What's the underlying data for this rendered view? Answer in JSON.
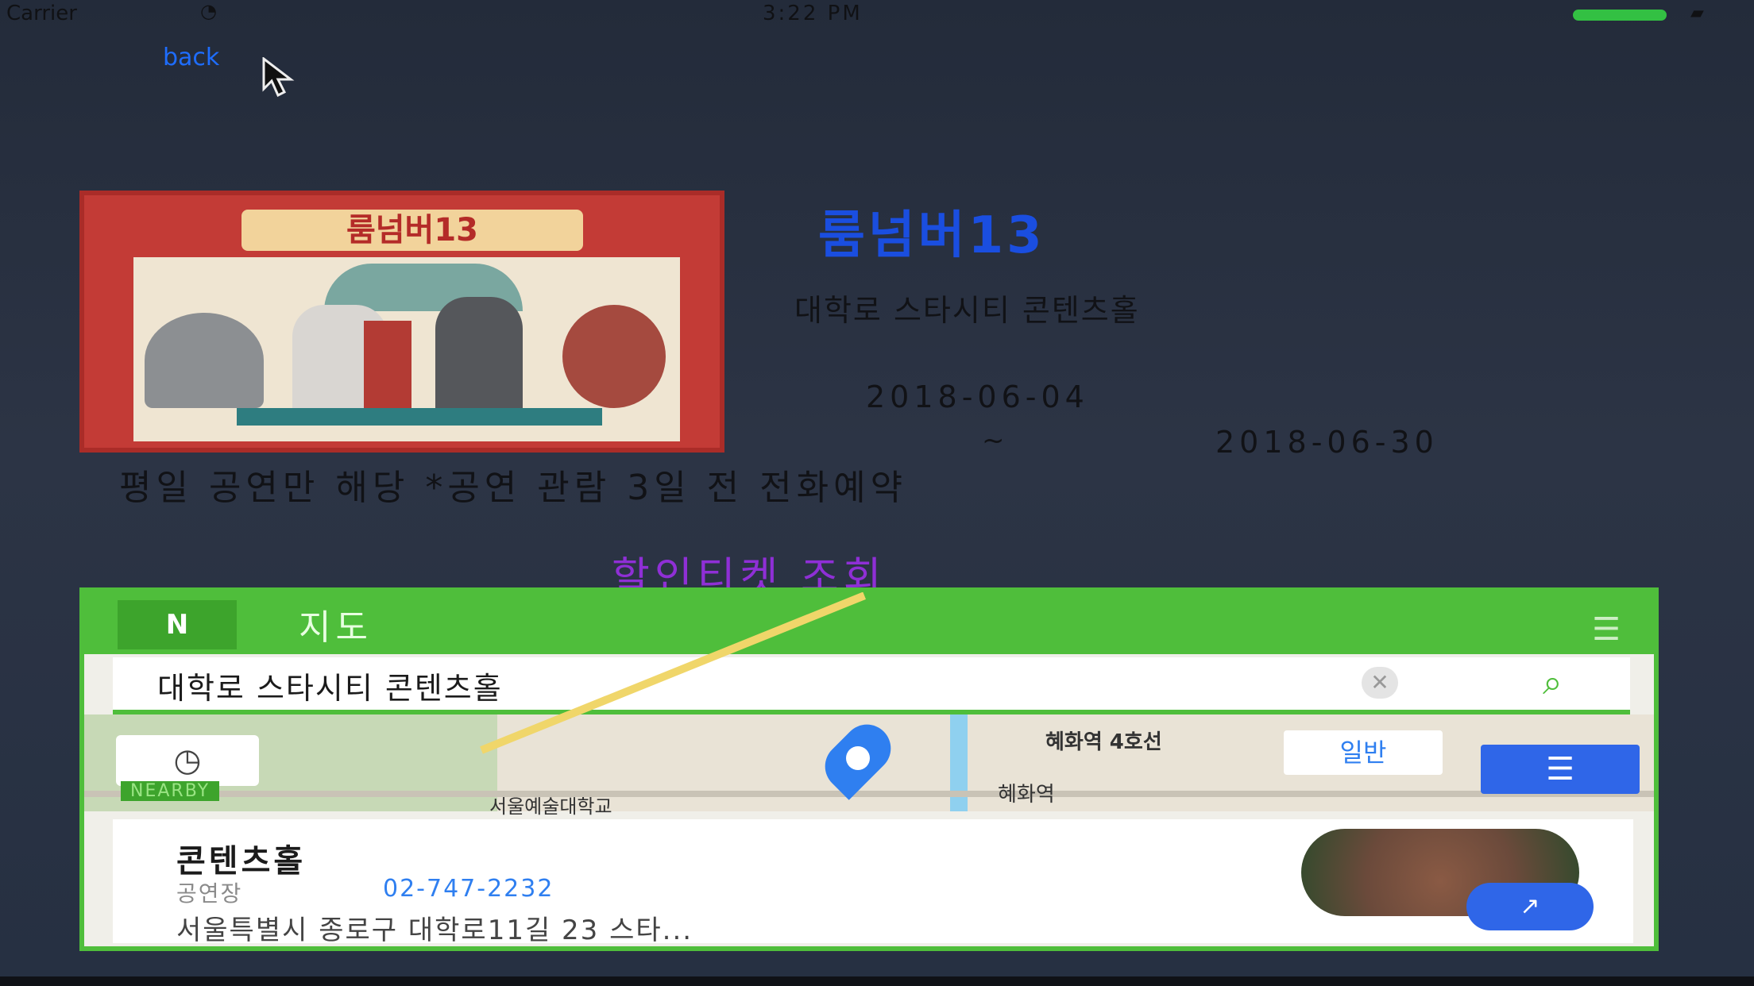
{
  "status": {
    "carrier": "Carrier",
    "wifi_icon": "◔",
    "time": "3:22 PM",
    "battery_tip": "▰"
  },
  "nav": {
    "back_label": "back"
  },
  "poster": {
    "title": "룸넘버13"
  },
  "show": {
    "title": "룸넘버13",
    "venue": "대학로 스타시티 콘텐츠홀",
    "date_start": "2018-06-04",
    "tilde": "~",
    "date_end": "2018-06-30",
    "notice": "평일 공연만 해당 *공연 관람 3일 전 전화예약",
    "discount_link": "할인티켓 조회"
  },
  "map": {
    "logo": "N",
    "label": "지도",
    "menu_icon": "☰",
    "search_value": "대학로 스타시티 콘텐츠홀",
    "clear_icon": "✕",
    "search_icon": "⌕",
    "clock_icon": "◷",
    "nearby_label": "NEARBY",
    "subway_label": "혜화역 4호선",
    "station_label": "혜화역",
    "university_label": "서울예술대학교",
    "normal_button": "일반",
    "list_button": "☰",
    "card": {
      "name": "콘텐츠홀",
      "category": "공연장",
      "phone": "02-747-2232",
      "address": "서울특별시 종로구 대학로11길 23 스타...",
      "directions_icon": "↗"
    }
  },
  "colors": {
    "accent_blue": "#1a4ee0",
    "discount_purple": "#8f2fd6",
    "map_green": "#4fbe3b"
  }
}
